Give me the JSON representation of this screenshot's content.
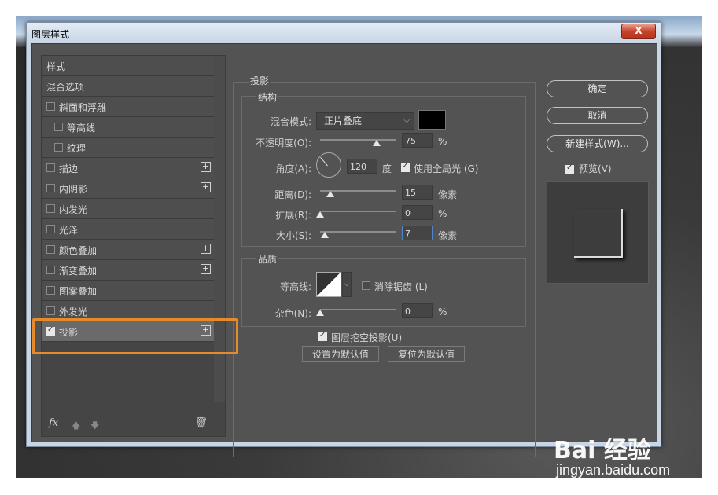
{
  "window": {
    "title": "图层样式",
    "close_glyph": "X"
  },
  "left_panel": {
    "items": [
      {
        "label": "样式",
        "checkbox": false,
        "indent": false,
        "plus": false
      },
      {
        "label": "混合选项",
        "checkbox": false,
        "indent": false,
        "plus": false
      },
      {
        "label": "斜面和浮雕",
        "checkbox": true,
        "checked": false,
        "indent": false,
        "plus": false
      },
      {
        "label": "等高线",
        "checkbox": true,
        "checked": false,
        "indent": true,
        "plus": false
      },
      {
        "label": "纹理",
        "checkbox": true,
        "checked": false,
        "indent": true,
        "plus": false
      },
      {
        "label": "描边",
        "checkbox": true,
        "checked": false,
        "indent": false,
        "plus": true
      },
      {
        "label": "内阴影",
        "checkbox": true,
        "checked": false,
        "indent": false,
        "plus": true
      },
      {
        "label": "内发光",
        "checkbox": true,
        "checked": false,
        "indent": false,
        "plus": false
      },
      {
        "label": "光泽",
        "checkbox": true,
        "checked": false,
        "indent": false,
        "plus": false
      },
      {
        "label": "颜色叠加",
        "checkbox": true,
        "checked": false,
        "indent": false,
        "plus": true
      },
      {
        "label": "渐变叠加",
        "checkbox": true,
        "checked": false,
        "indent": false,
        "plus": true
      },
      {
        "label": "图案叠加",
        "checkbox": true,
        "checked": false,
        "indent": false,
        "plus": false
      },
      {
        "label": "外发光",
        "checkbox": true,
        "checked": false,
        "indent": false,
        "plus": false
      },
      {
        "label": "投影",
        "checkbox": true,
        "checked": true,
        "indent": false,
        "plus": true,
        "selected": true
      }
    ],
    "footer": {
      "fx": "fx",
      "up": "🡅",
      "down": "🡇",
      "trash": "🗑"
    }
  },
  "drop_shadow": {
    "title": "投影",
    "structure": {
      "title": "结构",
      "blend_mode_label": "混合模式:",
      "blend_mode_value": "正片叠底",
      "color": "#000000",
      "opacity_label": "不透明度(O):",
      "opacity_value": "75",
      "opacity_unit": "%",
      "opacity_level": 0.75,
      "angle_label": "角度(A):",
      "angle_value": "120",
      "angle_unit": "度",
      "global_light_label": "使用全局光 (G)",
      "global_light_checked": true,
      "distance_label": "距离(D):",
      "distance_value": "15",
      "distance_unit": "像素",
      "spread_label": "扩展(R):",
      "spread_value": "0",
      "spread_unit": "%",
      "size_label": "大小(S):",
      "size_value": "7",
      "size_unit": "像素"
    },
    "quality": {
      "title": "品质",
      "contour_label": "等高线:",
      "anti_alias_label": "消除锯齿 (L)",
      "anti_alias_checked": false,
      "noise_label": "杂色(N):",
      "noise_value": "0",
      "noise_unit": "%"
    },
    "knockout_label": "图层挖空投影(U)",
    "knockout_checked": true,
    "make_default": "设置为默认值",
    "reset_default": "复位为默认值"
  },
  "right_buttons": {
    "ok": "确定",
    "cancel": "取消",
    "new_style": "新建样式(W)...",
    "preview_label": "预览(V)",
    "preview_checked": true
  },
  "watermark": {
    "brand": "Bai 经验",
    "url": "jingyan.baidu.com"
  },
  "colors": {
    "accent_highlight": "#e68a2e",
    "panel": "#535353",
    "field_focus": "#4f86c6"
  }
}
